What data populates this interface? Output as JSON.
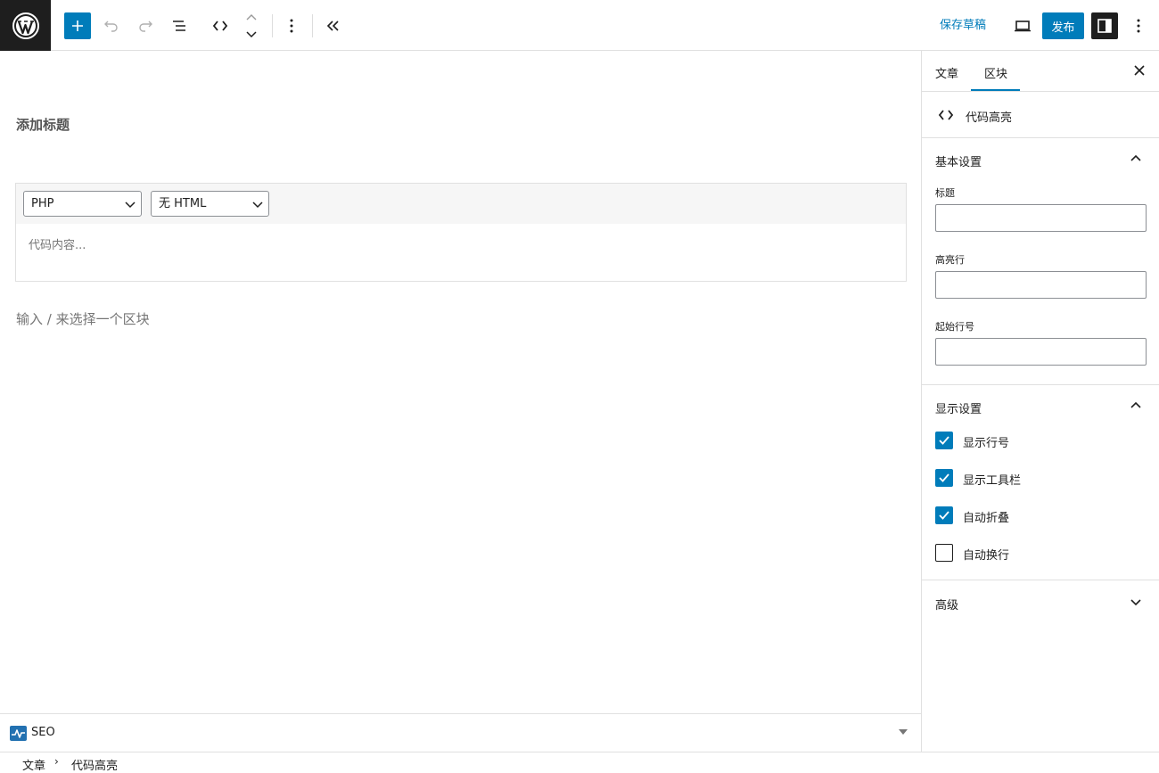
{
  "header": {
    "save_draft": "保存草稿",
    "publish": "发布"
  },
  "editor": {
    "title_placeholder": "添加标题",
    "code_block": {
      "language_select": "PHP",
      "mode_select": "无 HTML",
      "content_placeholder": "代码内容..."
    },
    "appender_placeholder": "输入 / 来选择一个区块"
  },
  "seo_bar": {
    "label": "SEO"
  },
  "breadcrumb": {
    "items": [
      "文章",
      "代码高亮"
    ]
  },
  "sidebar": {
    "tabs": [
      {
        "label": "文章",
        "active": false
      },
      {
        "label": "区块",
        "active": true
      }
    ],
    "block": {
      "name": "代码高亮"
    },
    "basic_settings": {
      "heading": "基本设置",
      "fields": [
        {
          "label": "标题",
          "value": ""
        },
        {
          "label": "高亮行",
          "value": ""
        },
        {
          "label": "起始行号",
          "value": ""
        }
      ]
    },
    "display_settings": {
      "heading": "显示设置",
      "options": [
        {
          "label": "显示行号",
          "checked": true
        },
        {
          "label": "显示工具栏",
          "checked": true
        },
        {
          "label": "自动折叠",
          "checked": true
        },
        {
          "label": "自动换行",
          "checked": false
        }
      ]
    },
    "advanced": {
      "heading": "高级"
    }
  },
  "colors": {
    "accent": "#007cba",
    "dark": "#1e1e1e"
  }
}
